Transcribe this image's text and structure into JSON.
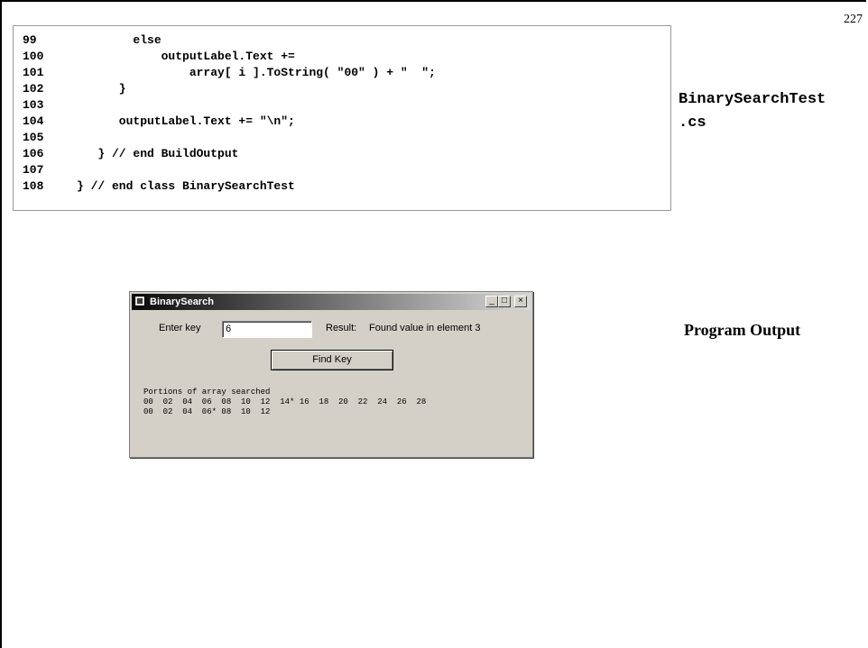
{
  "page_number": "227",
  "code_lines": [
    {
      "num": "99",
      "text": "        else"
    },
    {
      "num": "100",
      "text": "            outputLabel.Text +="
    },
    {
      "num": "101",
      "text": "                array[ i ].ToString( \"00\" ) + \"  \";"
    },
    {
      "num": "102",
      "text": "      }"
    },
    {
      "num": "103",
      "text": ""
    },
    {
      "num": "104",
      "text": "      outputLabel.Text += \"\\n\";"
    },
    {
      "num": "105",
      "text": ""
    },
    {
      "num": "106",
      "text": "   } // end BuildOutput"
    },
    {
      "num": "107",
      "text": ""
    },
    {
      "num": "108",
      "text": "} // end class BinarySearchTest"
    }
  ],
  "file_name": "BinarySearchTest\n.cs",
  "output_label": "Program Output",
  "window": {
    "title": "BinarySearch",
    "minimize": "_",
    "maximize": "□",
    "close": "×",
    "enter_key_label": "Enter key",
    "key_value": "6",
    "result_label": "Result:",
    "result_text": "Found value in element 3",
    "find_button": "Find Key",
    "output_lines": [
      "Portions of array searched",
      "00  02  04  06  08  10  12  14* 16  18  20  22  24  26  28",
      "00  02  04  06* 08  10  12"
    ]
  }
}
